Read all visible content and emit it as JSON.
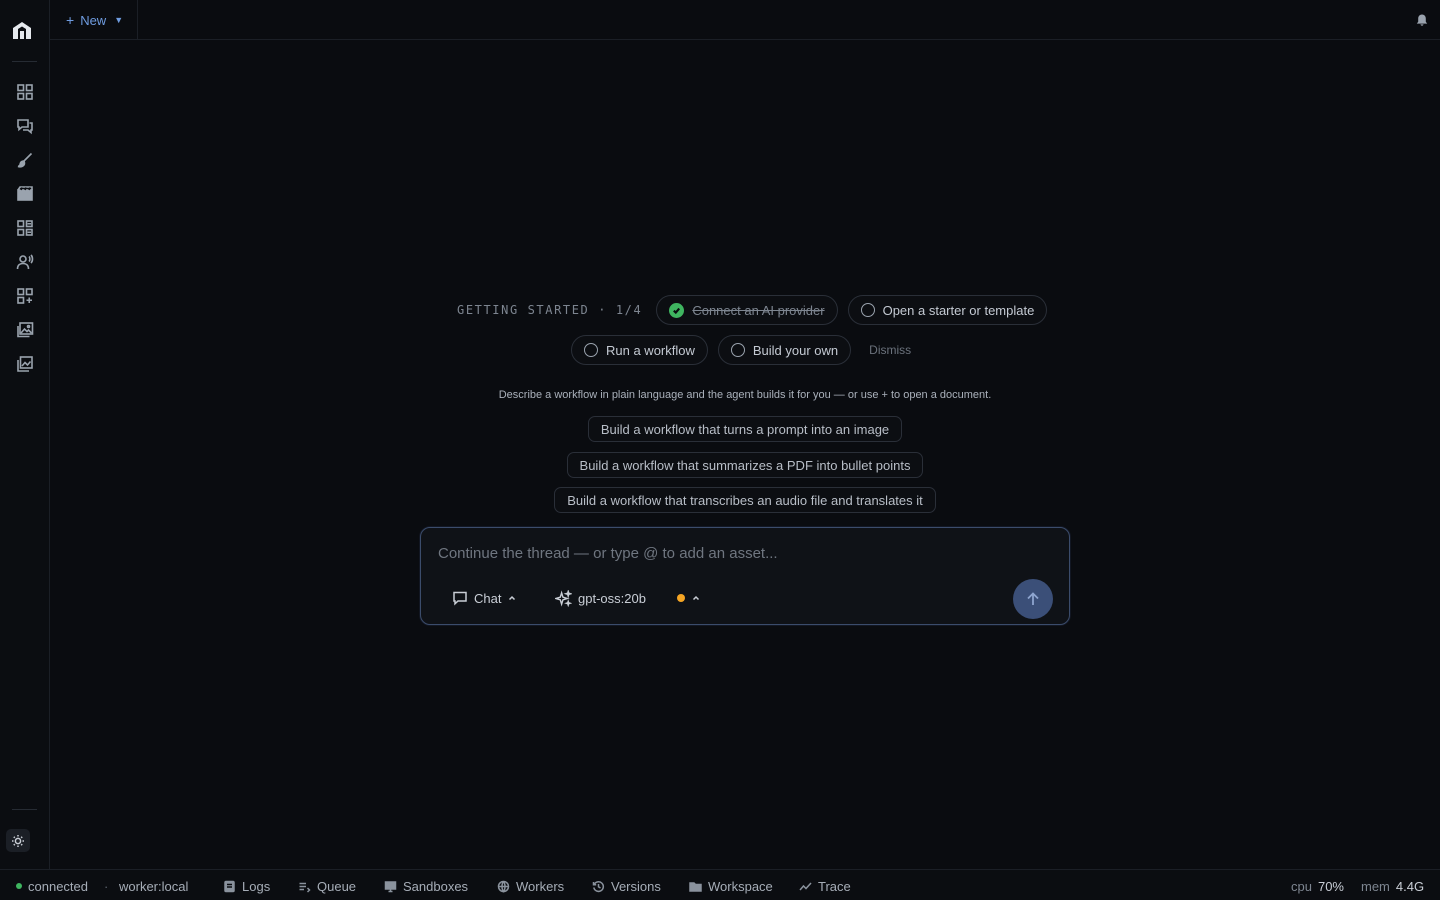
{
  "topbar": {
    "new_label": "New",
    "new_plus": "+",
    "new_caret": "▼"
  },
  "sidebar": {
    "items": [
      {
        "name": "dashboard-icon"
      },
      {
        "name": "chat-icon"
      },
      {
        "name": "brush-icon"
      },
      {
        "name": "video-icon"
      },
      {
        "name": "grid-icon"
      },
      {
        "name": "voice-icon"
      },
      {
        "name": "apps-add-icon"
      },
      {
        "name": "gallery-icon"
      },
      {
        "name": "library-icon"
      }
    ]
  },
  "getting_started": {
    "label": "GETTING STARTED · 1/4",
    "steps": [
      {
        "label": "Connect an AI provider",
        "done": true
      },
      {
        "label": "Open a starter or template",
        "done": false
      },
      {
        "label": "Run a workflow",
        "done": false
      },
      {
        "label": "Build your own",
        "done": false
      }
    ],
    "dismiss": "Dismiss"
  },
  "description": "Describe a workflow in plain language and the agent builds it for you — or use + to open a document.",
  "suggestions": [
    "Build a workflow that turns a prompt into an image",
    "Build a workflow that summarizes a PDF into bullet points",
    "Build a workflow that transcribes an audio file and translates it"
  ],
  "composer": {
    "placeholder": "Continue the thread — or type @ to add an asset...",
    "mode": "Chat",
    "model": "gpt-oss:20b",
    "status_color": "#f5a524"
  },
  "statusbar": {
    "connection": "connected",
    "separator": "·",
    "worker": "worker:local",
    "items": [
      "Logs",
      "Queue",
      "Sandboxes",
      "Workers",
      "Versions",
      "Workspace",
      "Trace"
    ],
    "cpu_label": "cpu",
    "cpu_value": "70%",
    "mem_label": "mem",
    "mem_value": "4.4G"
  },
  "colors": {
    "accent": "#6f9ce0",
    "success": "#3fb560",
    "background": "#0a0c10"
  }
}
